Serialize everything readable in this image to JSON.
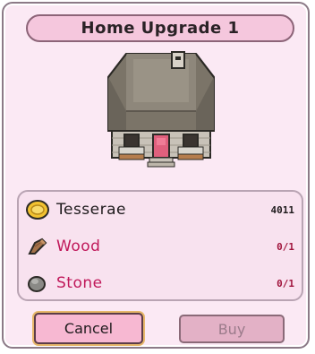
{
  "dialog": {
    "title": "Home Upgrade 1"
  },
  "resources": [
    {
      "icon": "tesserae-coin-icon",
      "label": "Tesserae",
      "count": "4011",
      "status": "ok"
    },
    {
      "icon": "wood-log-icon",
      "label": "Wood",
      "count": "0/1",
      "status": "missing"
    },
    {
      "icon": "stone-icon",
      "label": "Stone",
      "count": "0/1",
      "status": "missing"
    }
  ],
  "buttons": {
    "cancel_label": "Cancel",
    "buy_label": "Buy"
  },
  "colors": {
    "panel_bg": "#fbe9f4",
    "accent_pink": "#f5c7dd",
    "missing_text": "#c0185a",
    "cancel_focus": "#e7b76a"
  }
}
